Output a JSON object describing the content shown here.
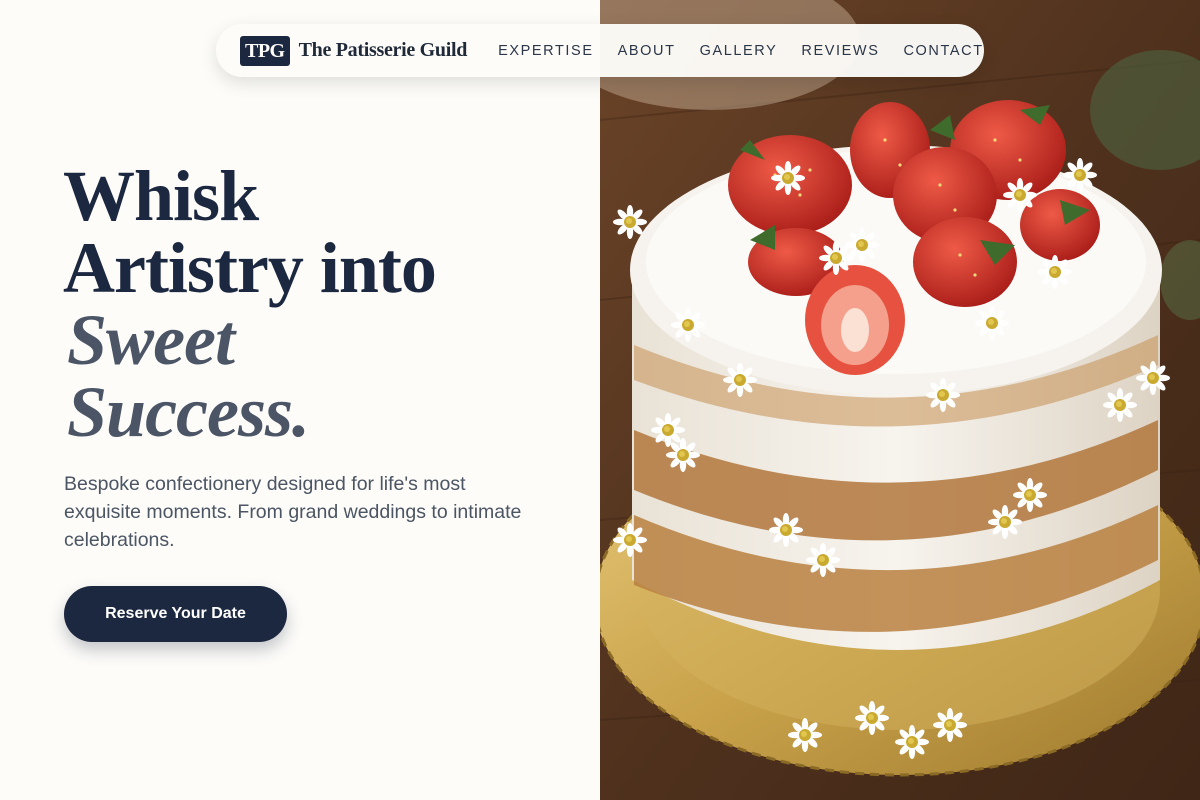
{
  "brand": {
    "mark": "TPG",
    "name": "The Patisserie Guild"
  },
  "nav": {
    "items": [
      "EXPERTISE",
      "ABOUT",
      "GALLERY",
      "REVIEWS",
      "CONTACT"
    ]
  },
  "hero": {
    "title_line1": "Whisk",
    "title_line2": "Artistry into",
    "title_accent_line1": "Sweet",
    "title_accent_line2": "Success.",
    "subtitle": "Bespoke confectionery designed for life's most exquisite moments. From grand weddings to intimate celebrations.",
    "cta_label": "Reserve Your Date"
  },
  "colors": {
    "navy": "#1c2740",
    "slate": "#4b5566",
    "cream_background": "#fdfcf9",
    "strawberry": "#c62a22",
    "gold_board": "#c9a24a",
    "wood": "#5a3a24"
  },
  "image": {
    "subject": "naked-cake-with-strawberries-and-chamomile"
  }
}
